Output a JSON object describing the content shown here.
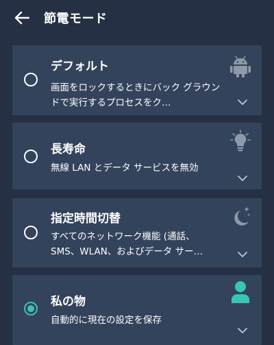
{
  "header": {
    "title": "節電モード"
  },
  "modes": [
    {
      "title": "デフォルト",
      "description": "画面をロックするときにバック グラウンドで実行するプロセスをク…",
      "icon": "android-icon",
      "selected": false
    },
    {
      "title": "長寿命",
      "description": "無線 LAN とデータ サービスを無効",
      "icon": "lightbulb-icon",
      "selected": false
    },
    {
      "title": "指定時間切替",
      "description": "すべてのネットワーク機能 (通話、SMS、WLAN、およびデータ サー…",
      "icon": "moon-stars-icon",
      "selected": false
    },
    {
      "title": "私の物",
      "description": "自動的に現在の設定を保存",
      "icon": "person-icon",
      "selected": true
    }
  ],
  "colors": {
    "background": "#253044",
    "card": "#34435c",
    "accent": "#37c6b2",
    "icon_muted": "#8f99a8"
  }
}
